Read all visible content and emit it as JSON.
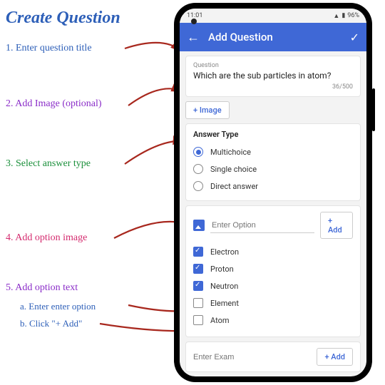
{
  "instructions": {
    "title": "Create Question",
    "step1": "1. Enter question title",
    "step2": "2. Add Image (optional)",
    "step3": "3. Select answer type",
    "step4": "4. Add option image",
    "step5": "5. Add option text",
    "step5a": "a. Enter enter option",
    "step5b": "b. Click \"+ Add\""
  },
  "status": {
    "time": "11:01",
    "battery": "96%"
  },
  "appbar": {
    "title": "Add Question"
  },
  "question": {
    "label": "Question",
    "title": "Which are the sub particles in atom?",
    "counter": "36/500"
  },
  "buttons": {
    "image": "+ Image",
    "add": "+ Add"
  },
  "answer_type": {
    "heading": "Answer Type",
    "options": [
      {
        "label": "Multichoice",
        "checked": true
      },
      {
        "label": "Single choice",
        "checked": false
      },
      {
        "label": "Direct answer",
        "checked": false
      }
    ]
  },
  "option_input": {
    "placeholder": "Enter Option"
  },
  "options_list": [
    {
      "label": "Electron",
      "checked": true
    },
    {
      "label": "Proton",
      "checked": true
    },
    {
      "label": "Neutron",
      "checked": true
    },
    {
      "label": "Element",
      "checked": false
    },
    {
      "label": "Atom",
      "checked": false
    }
  ],
  "exam": {
    "placeholder": "Enter Exam"
  }
}
